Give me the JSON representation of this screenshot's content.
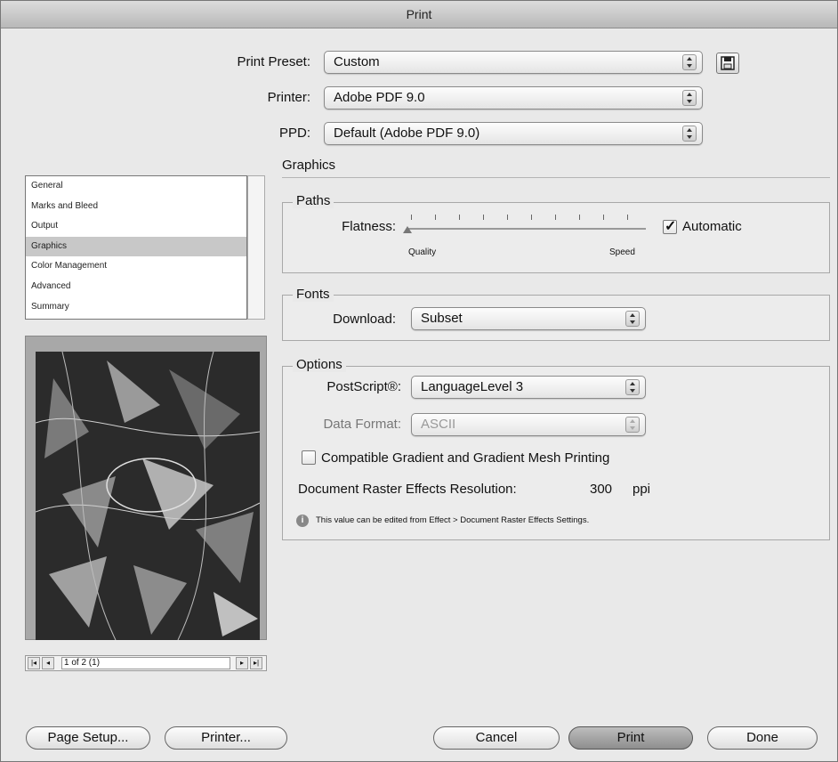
{
  "window": {
    "title": "Print"
  },
  "header": {
    "print_preset_label": "Print Preset:",
    "print_preset_value": "Custom",
    "printer_label": "Printer:",
    "printer_value": "Adobe PDF 9.0",
    "ppd_label": "PPD:",
    "ppd_value": "Default (Adobe PDF 9.0)"
  },
  "sidebar": {
    "items": [
      {
        "label": "General"
      },
      {
        "label": "Marks and Bleed"
      },
      {
        "label": "Output"
      },
      {
        "label": "Graphics"
      },
      {
        "label": "Color Management"
      },
      {
        "label": "Advanced"
      },
      {
        "label": "Summary"
      }
    ],
    "selected": "Graphics"
  },
  "preview": {
    "page_indicator": "1 of 2 (1)"
  },
  "graphics": {
    "title": "Graphics",
    "paths": {
      "legend": "Paths",
      "flatness_label": "Flatness:",
      "quality_label": "Quality",
      "speed_label": "Speed",
      "automatic_label": "Automatic",
      "automatic_checked": true,
      "flatness_level": 0
    },
    "fonts": {
      "legend": "Fonts",
      "download_label": "Download:",
      "download_value": "Subset"
    },
    "options": {
      "legend": "Options",
      "postscript_label": "PostScript®:",
      "postscript_value": "LanguageLevel 3",
      "data_format_label": "Data Format:",
      "data_format_value": "ASCII",
      "gradient_label": "Compatible Gradient and Gradient Mesh Printing",
      "gradient_checked": false,
      "resolution_label": "Document Raster Effects Resolution:",
      "resolution_value": "300",
      "resolution_unit": "ppi",
      "info_text": "This value can be edited from Effect > Document Raster Effects Settings."
    }
  },
  "footer": {
    "page_setup": "Page Setup...",
    "printer": "Printer...",
    "cancel": "Cancel",
    "print": "Print",
    "done": "Done"
  }
}
